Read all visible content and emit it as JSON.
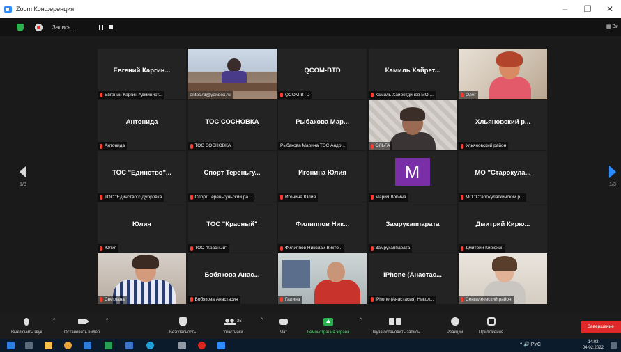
{
  "window": {
    "title": "Zoom Конференция",
    "controls": [
      "–",
      "❐",
      "✕"
    ]
  },
  "meeting_bar": {
    "recording_label": "Запись...",
    "view_label": "▦ Ви"
  },
  "tiles": [
    {
      "name": "Евгений Каргин...",
      "label": "Евгений Каргин Админист...",
      "muted": true
    },
    {
      "name": "",
      "label": "antos73@yandex.ru",
      "muted": false,
      "video": "office",
      "active": true
    },
    {
      "name": "QCOM-BTD",
      "label": "QCOM-BTD",
      "muted": true
    },
    {
      "name": "Камиль Хайрет...",
      "label": "Камиль Хайретдинов МО ...",
      "muted": true
    },
    {
      "name": "",
      "label": "Олег",
      "muted": true,
      "video": "woman-red"
    },
    {
      "name": "Антонида",
      "label": "Антонида",
      "muted": true
    },
    {
      "name": "ТОС СОСНОВКА",
      "label": "ТОС СОСНОВКА",
      "muted": true
    },
    {
      "name": "Рыбакова Мар...",
      "label": "Рыбакова Марина ТОС Андр...",
      "muted": false
    },
    {
      "name": "",
      "label": "ОЛЬГА",
      "muted": true,
      "video": "floral"
    },
    {
      "name": "Хльяновский р...",
      "label": "Ульяновский район",
      "muted": true
    },
    {
      "name": "ТОС \"Единство\"...",
      "label": "ТОС \"Единство\"с.Дубровка",
      "muted": true
    },
    {
      "name": "Спорт Тереньгу...",
      "label": "Спорт Тереньгульский ра...",
      "muted": true
    },
    {
      "name": "Игонина Юлия",
      "label": "Игонина Юлия",
      "muted": true
    },
    {
      "name": "",
      "label": "Мария Лобина",
      "muted": true,
      "avatar": "M"
    },
    {
      "name": "МО \"Старокула...",
      "label": "МО \"Старокулаткинский р...",
      "muted": true
    },
    {
      "name": "Юлия",
      "label": "Юлия",
      "muted": true
    },
    {
      "name": "ТОС \"Красный\"",
      "label": "ТОС \"Красный\"",
      "muted": true
    },
    {
      "name": "Филиппов Ник...",
      "label": "Филиппов Николай Викто...",
      "muted": true
    },
    {
      "name": "Замрукаппарата",
      "label": "Замрукаппарата",
      "muted": true
    },
    {
      "name": "Дмитрий Кирю...",
      "label": "Дмитрий Кирюхин",
      "muted": true
    },
    {
      "name": "",
      "label": "Светлана",
      "muted": true,
      "video": "svet"
    },
    {
      "name": "Бобякова Анас...",
      "label": "Бобякова Анастасия",
      "muted": true
    },
    {
      "name": "",
      "label": "Галина",
      "muted": true,
      "video": "galina"
    },
    {
      "name": "iPhone (Анастас...",
      "label": "iPhone (Анастасия) Никол...",
      "muted": true
    },
    {
      "name": "",
      "label": "Сенгилеевский район",
      "muted": true,
      "video": "sengi"
    }
  ],
  "page_nav": {
    "left_page": "1/3",
    "right_page": "1/3"
  },
  "toolbar": {
    "mute": "Выключить звук",
    "stop_video": "Остановить видео",
    "security": "Безопасность",
    "participants": "Участники",
    "participants_count": "25",
    "chat": "Чат",
    "share_screen": "Демонстрация экрана",
    "pause_recording": "Пауза/остановить запись",
    "reactions": "Реакции",
    "apps": "Приложения",
    "end": "Завершение"
  },
  "taskbar": {
    "tray": "^  🔊  РУС",
    "time": "14:02",
    "date": "04.02.2022"
  },
  "colors": {
    "active_speaker": "#a6e22e",
    "end_button": "#e02828",
    "share_green": "#2bb24c",
    "nav_blue": "#2d8cff",
    "avatar_purple": "#7a2fa8"
  }
}
